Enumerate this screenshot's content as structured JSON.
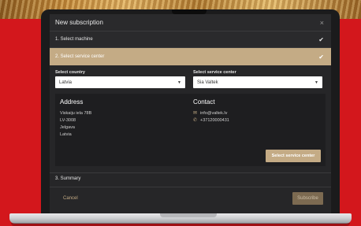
{
  "modal": {
    "title": "New subscription",
    "close_glyph": "×"
  },
  "steps": [
    {
      "label": "1. Select machine",
      "completed": true
    },
    {
      "label": "2. Select service center",
      "completed": true,
      "active": true
    },
    {
      "label": "3. Summary",
      "completed": false
    }
  ],
  "check_glyph": "✔",
  "country": {
    "label": "Select country",
    "value": "Latvia"
  },
  "service_center": {
    "label": "Select service center",
    "value": "Sia Valtek"
  },
  "address": {
    "title": "Address",
    "lines": [
      "Viskaiju iela 78B",
      "LV-3008",
      "Jelgava",
      "Latvia"
    ]
  },
  "contact": {
    "title": "Contact",
    "email": "info@valtek.lv",
    "phone": "+37120000431",
    "email_icon": "envelope-icon",
    "phone_icon": "phone-icon"
  },
  "buttons": {
    "select_service_center": "Select service center",
    "cancel": "Cancel",
    "subscribe": "Subscribe"
  },
  "colors": {
    "accent": "#c4ab85",
    "background_red": "#d3171c",
    "modal_bg": "#262628"
  }
}
